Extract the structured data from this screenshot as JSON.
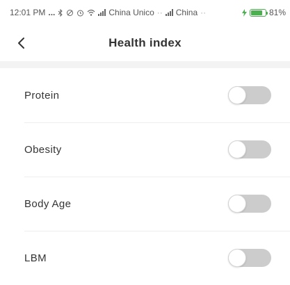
{
  "status_bar": {
    "time": "12:01 PM",
    "dots": "...",
    "carrier1": "China Unico",
    "carrier2": "China",
    "battery_pct": "81%",
    "battery_level": 0.81
  },
  "header": {
    "title": "Health index",
    "back_icon": "chevron-left-icon"
  },
  "settings": {
    "items": [
      {
        "label": "Protein",
        "enabled": false
      },
      {
        "label": "Obesity",
        "enabled": false
      },
      {
        "label": "Body Age",
        "enabled": false
      },
      {
        "label": "LBM",
        "enabled": false
      }
    ]
  },
  "colors": {
    "toggle_off": "#cccccc",
    "battery": "#4caf50",
    "title": "#333333"
  }
}
